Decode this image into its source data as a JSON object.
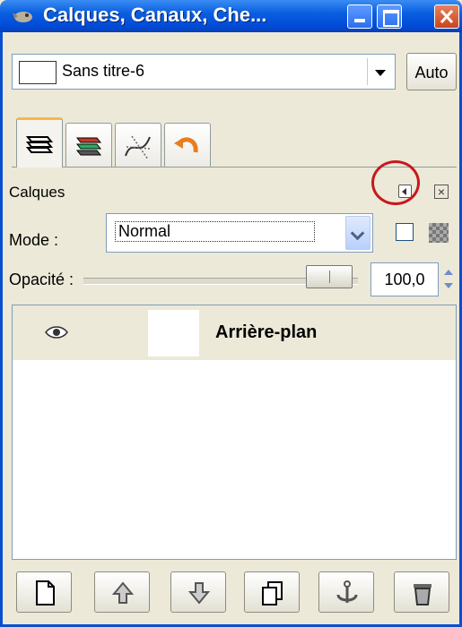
{
  "window": {
    "title": "Calques, Canaux, Che..."
  },
  "image_selector": {
    "value": "Sans titre-6",
    "auto_label": "Auto"
  },
  "tabs": [
    {
      "name": "layers"
    },
    {
      "name": "channels"
    },
    {
      "name": "paths"
    },
    {
      "name": "undo-history"
    }
  ],
  "dock": {
    "label": "Calques"
  },
  "mode": {
    "label": "Mode :",
    "value": "Normal"
  },
  "opacity": {
    "label": "Opacité :",
    "value": "100,0",
    "level": 1.0
  },
  "layers": [
    {
      "name": "Arrière-plan",
      "visible": true
    }
  ],
  "buttons": [
    {
      "icon": "new-layer-icon"
    },
    {
      "icon": "raise-layer-icon"
    },
    {
      "icon": "lower-layer-icon"
    },
    {
      "icon": "duplicate-layer-icon"
    },
    {
      "icon": "anchor-layer-icon"
    },
    {
      "icon": "delete-layer-icon"
    }
  ],
  "colors": {
    "titlebar": "#0a5fe0",
    "highlight_circle": "#c8181d",
    "window_bg": "#ece9d8"
  }
}
